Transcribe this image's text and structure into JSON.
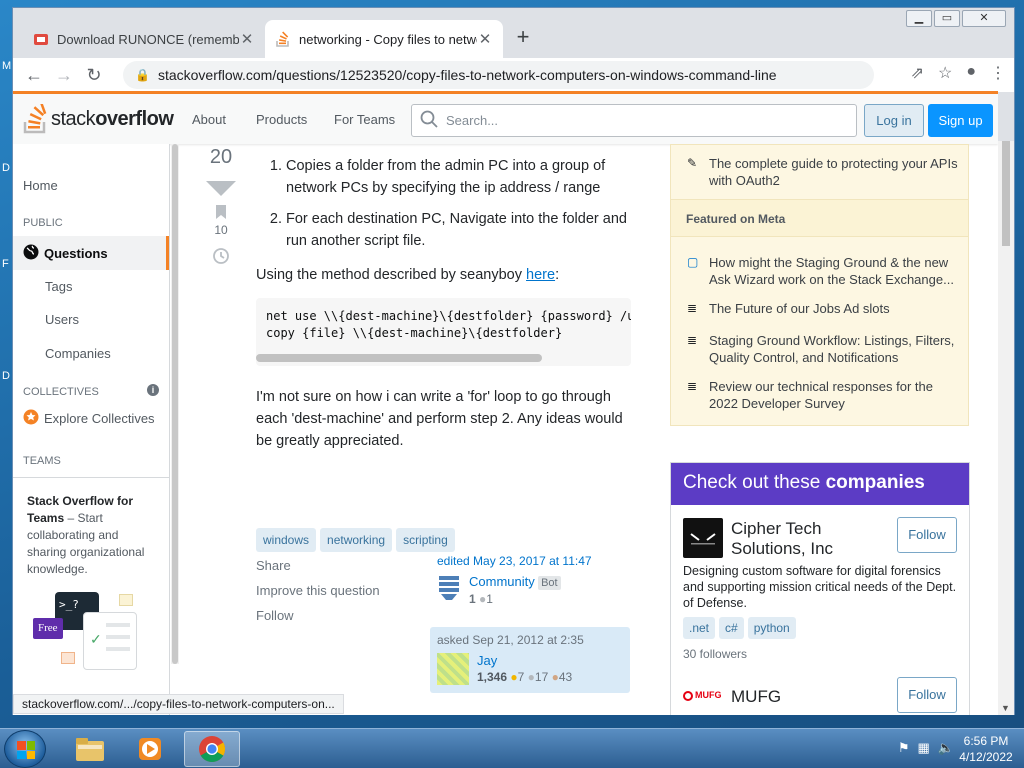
{
  "browser": {
    "tabs": [
      {
        "title": "Download RUNONCE (remember",
        "active": false
      },
      {
        "title": "networking - Copy files to netwo",
        "active": true
      }
    ],
    "url": "stackoverflow.com/questions/12523520/copy-files-to-network-computers-on-windows-command-line",
    "status_url": "stackoverflow.com/.../copy-files-to-network-computers-on..."
  },
  "header": {
    "logo_light": "stack",
    "logo_bold": "overflow",
    "links": [
      "About",
      "Products",
      "For Teams"
    ],
    "search_placeholder": "Search...",
    "login": "Log in",
    "signup": "Sign up"
  },
  "leftnav": {
    "home": "Home",
    "public": "PUBLIC",
    "questions": "Questions",
    "tags": "Tags",
    "users": "Users",
    "companies": "Companies",
    "collectives": "COLLECTIVES",
    "explore_collectives": "Explore Collectives",
    "teams": "TEAMS",
    "teams_title": "Stack Overflow for Teams",
    "teams_desc": " – Start collaborating and sharing organizational knowledge.",
    "free_badge": "Free"
  },
  "vote": {
    "score": "20",
    "bookmarks": "10"
  },
  "post": {
    "steps": [
      "Copies a folder from the admin PC into a group of network PCs by specifying the ip address / range",
      "For each destination PC, Navigate into the folder and run another script file."
    ],
    "method_text": "Using the method described by seanyboy ",
    "method_link": "here",
    "method_colon": ":",
    "code": "net use \\\\{dest-machine}\\{destfolder} {password} /u\ncopy {file} \\\\{dest-machine}\\{destfolder}",
    "question": "I'm not sure on how i can write a 'for' loop to go through each 'dest-machine' and perform step 2. Any ideas would be greatly appreciated.",
    "tags": [
      "windows",
      "networking",
      "scripting"
    ],
    "menu": [
      "Share",
      "Improve this question",
      "Follow"
    ],
    "edited": "edited May 23, 2017 at 11:47",
    "editor": "Community",
    "editor_badge": "Bot",
    "editor_rep": "1",
    "editor_bronze": "1",
    "asked": "asked Sep 21, 2012 at 2:35",
    "asker": "Jay",
    "asker_rep": "1,346",
    "asker_gold": "7",
    "asker_silver": "17",
    "asker_bronze": "43"
  },
  "sidebar": {
    "blog_item": "The complete guide to protecting your APIs with OAuth2",
    "featured_head": "Featured on Meta",
    "meta_items": [
      "How might the Staging Ground & the new Ask Wizard work on the Stack Exchange...",
      "The Future of our Jobs Ad slots",
      "Staging Ground Workflow: Listings, Filters, Quality Control, and Notifications",
      "Review our technical responses for the 2022 Developer Survey"
    ],
    "companies_head_light": "Check out these ",
    "companies_head_bold": "companies",
    "company1_name": "Cipher Tech Solutions, Inc",
    "company1_desc": "Designing custom software for digital forensics and supporting mission critical needs of the Dept. of Defense.",
    "company1_tags": [
      ".net",
      "c#",
      "python"
    ],
    "company1_followers": "30 followers",
    "company2_name": "MUFG",
    "company2_logo_text": "MUFG",
    "follow": "Follow"
  },
  "taskbar": {
    "time": "6:56 PM",
    "date": "4/12/2022"
  }
}
